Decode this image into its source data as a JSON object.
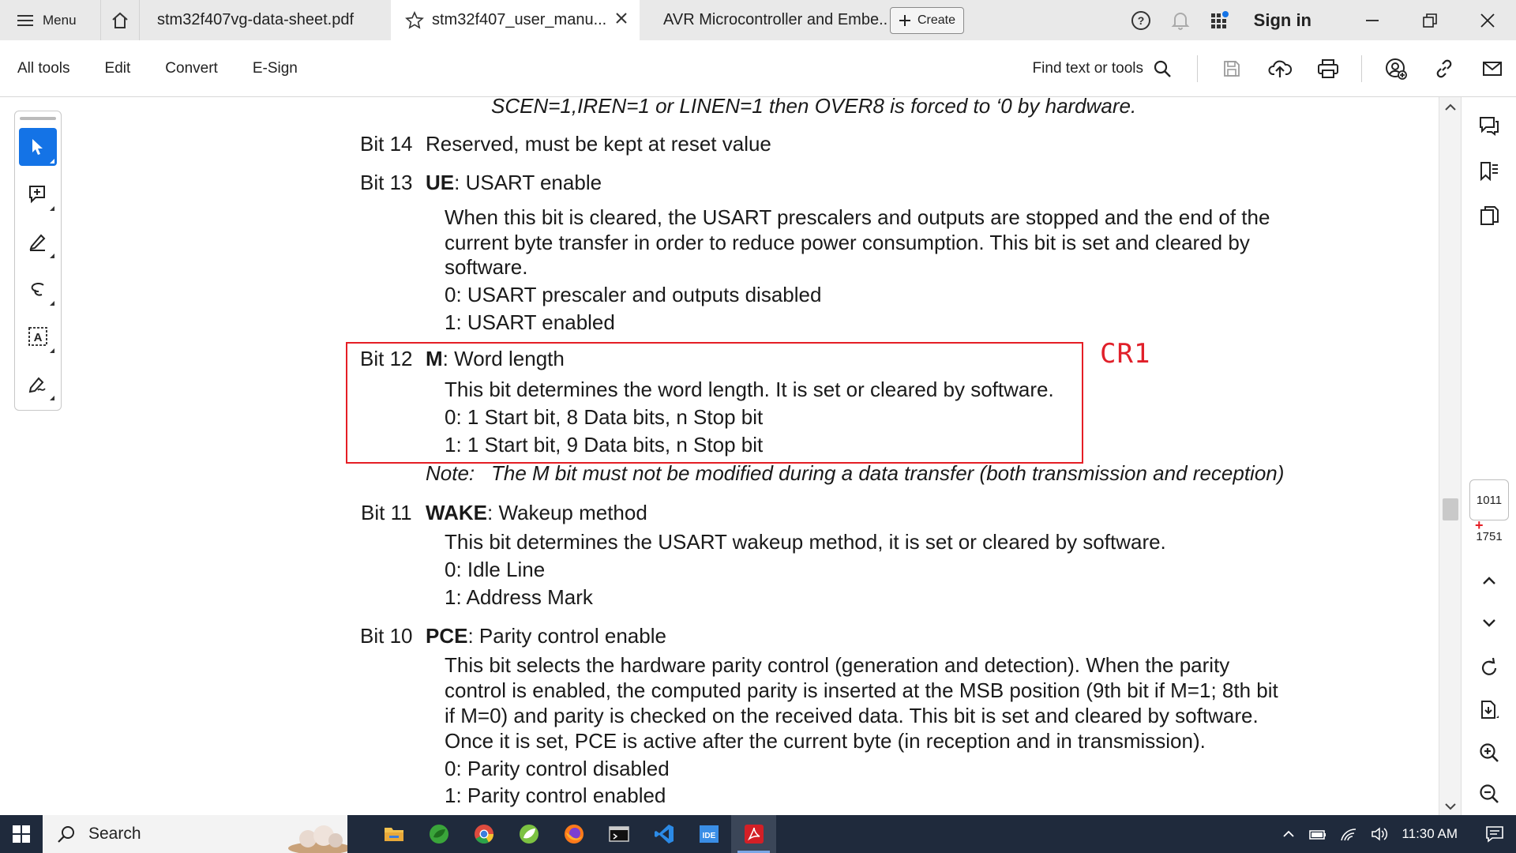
{
  "tabbar": {
    "menu_label": "Menu",
    "tabs": [
      {
        "label": "stm32f407vg-data-sheet.pdf"
      },
      {
        "label": "stm32f407_user_manu..."
      },
      {
        "label": "AVR Microcontroller and Embe..."
      }
    ],
    "create_label": "Create",
    "signin_label": "Sign in"
  },
  "toolbar": {
    "menu": [
      "All tools",
      "Edit",
      "Convert",
      "E-Sign"
    ],
    "find_label": "Find text or tools"
  },
  "document": {
    "lines": {
      "scen": "SCEN=1,IREN=1 or LINEN=1 then OVER8 is forced to ‘0 by hardware.",
      "bit14_num": "Bit 14",
      "bit14_text": "Reserved, must be kept at reset value",
      "bit13_num": "Bit 13",
      "bit13_name": "UE",
      "bit13_title": ": USART enable",
      "bit13_d1": "When this bit is cleared, the USART prescalers and outputs are stopped and the end of the",
      "bit13_d2": "current byte transfer in order to reduce power consumption. This bit is set and cleared by",
      "bit13_d3": "software.",
      "bit13_o0": "0: USART prescaler and outputs disabled",
      "bit13_o1": "1: USART enabled",
      "bit12_num": "Bit 12",
      "bit12_name": "M",
      "bit12_title": ": Word length",
      "bit12_d1": "This bit determines the word length. It is set or cleared by software.",
      "bit12_o0": "0: 1 Start bit, 8 Data bits, n Stop bit",
      "bit12_o1": "1: 1 Start bit, 9 Data bits, n Stop bit",
      "note_label": "Note:",
      "note_text": "The M bit must not be modified during a data transfer (both transmission and reception)",
      "bit11_num": "Bit 11",
      "bit11_name": "WAKE",
      "bit11_title": ": Wakeup method",
      "bit11_d1": "This bit determines the USART wakeup method, it is set or cleared by software.",
      "bit11_o0": "0: Idle Line",
      "bit11_o1": "1: Address Mark",
      "bit10_num": "Bit 10",
      "bit10_name": "PCE",
      "bit10_title": ": Parity control enable",
      "bit10_d1": "This bit selects the hardware parity control (generation and detection). When the parity",
      "bit10_d2": "control is enabled, the computed parity is inserted at the MSB position (9th bit if M=1; 8th bit",
      "bit10_d3": "if M=0) and parity is checked on the received data. This bit is set and cleared by software.",
      "bit10_d4": "Once it is set, PCE is active after the current byte (in reception and in transmission).",
      "bit10_o0": "0: Parity control disabled",
      "bit10_o1": "1: Parity control enabled"
    },
    "annotation": "CR1",
    "annotation_color": "#e51e25"
  },
  "pager": {
    "current": "1011",
    "total": "1751"
  },
  "taskbar": {
    "search_label": "Search",
    "time": "11:30 AM"
  },
  "icons": [
    "hamburger-icon",
    "home-icon",
    "star-icon",
    "close-icon",
    "plus-icon",
    "help-icon",
    "bell-icon",
    "apps-icon",
    "minimize-icon",
    "restore-icon",
    "search-icon",
    "save-icon",
    "upload-icon",
    "print-icon",
    "share-user-icon",
    "link-icon",
    "mail-icon",
    "cursor-icon",
    "comment-icon",
    "pen-icon",
    "lasso-icon",
    "text-select-icon",
    "signature-icon",
    "chat-icon",
    "bookmark-icon",
    "pages-icon",
    "chevron-up-icon",
    "chevron-down-icon",
    "rotate-icon",
    "export-page-icon",
    "zoom-in-icon",
    "zoom-out-icon",
    "windows-icon"
  ]
}
